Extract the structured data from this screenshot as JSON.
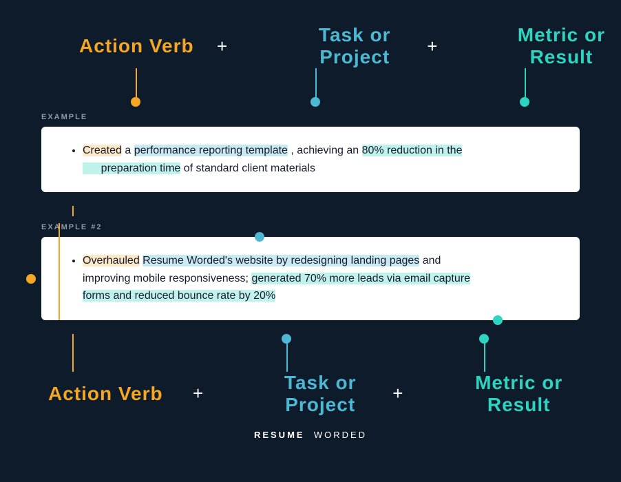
{
  "top_formula": {
    "action_verb": "Action Verb",
    "task_or_project": "Task or Project",
    "metric_or_result": "Metric or Result",
    "plus1": "+",
    "plus2": "+"
  },
  "bottom_formula": {
    "action_verb": "Action Verb",
    "task_or_project": "Task or Project",
    "metric_or_result": "Metric or Result",
    "plus1": "+",
    "plus2": "+"
  },
  "example1": {
    "label": "EXAMPLE",
    "bullet": {
      "action_part": "Created",
      "action_suffix": " a ",
      "task_part": "performance reporting template",
      "middle": ", achieving an ",
      "metric_part": "80% reduction in the preparation time",
      "suffix": " of standard client materials"
    }
  },
  "example2": {
    "label": "EXAMPLE #2",
    "bullet": {
      "action_part": "Overhauled",
      "task_part": " Resume Worded's website by redesigning landing pages",
      "middle": " and improving mobile responsiveness; ",
      "metric_part": "generated 70% more leads via email capture forms and reduced bounce rate by 20%",
      "suffix": ""
    }
  },
  "footer": {
    "resume": "RESUME",
    "worded": "WORDED"
  },
  "colors": {
    "orange": "#f5a623",
    "blue": "#4db8d4",
    "teal": "#2dd4bf",
    "background": "#0d1b2a",
    "highlight_orange": "rgba(245, 166, 35, 0.25)",
    "highlight_blue": "rgba(77, 184, 212, 0.3)",
    "highlight_teal": "rgba(45, 212, 191, 0.3)"
  }
}
